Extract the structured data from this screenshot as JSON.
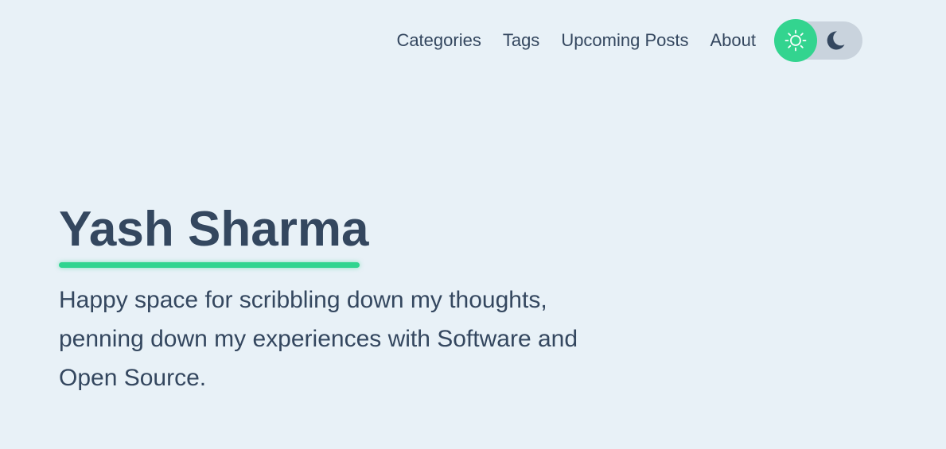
{
  "nav": {
    "links": [
      {
        "label": "Categories"
      },
      {
        "label": "Tags"
      },
      {
        "label": "Upcoming Posts"
      },
      {
        "label": "About"
      }
    ],
    "theme_toggle": {
      "active_mode": "light",
      "icons": [
        "sun-icon",
        "moon-icon"
      ]
    }
  },
  "hero": {
    "title": "Yash Sharma",
    "description": "Happy space for scribbling down my thoughts, penning down my experiences with Software and Open Source."
  },
  "colors": {
    "background": "#e8f1f7",
    "text": "#34475f",
    "accent": "#33d48f",
    "toggle_track": "#c9d3dd"
  }
}
